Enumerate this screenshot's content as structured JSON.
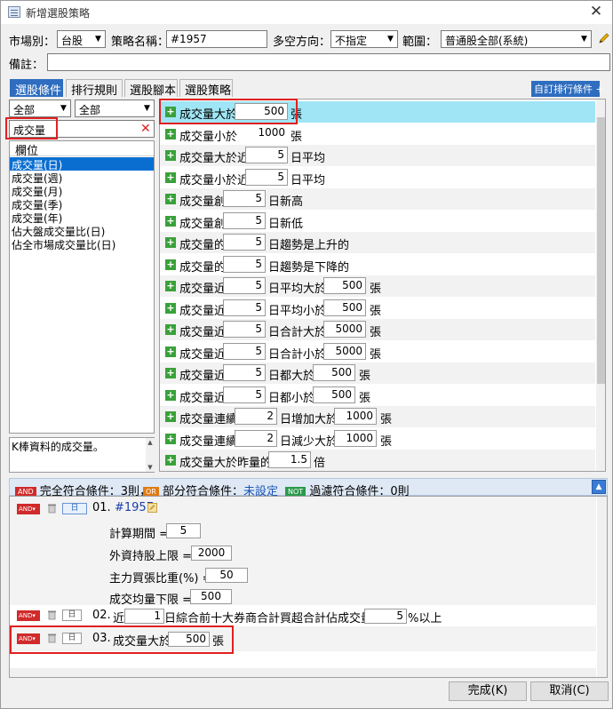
{
  "window": {
    "title": "新增選股策略",
    "close": "✕"
  },
  "header": {
    "market_label": "市場別：",
    "market_value": "台股",
    "strategy_label": "策略名稱：",
    "strategy_value": "#1957",
    "direction_label": "多空方向：",
    "direction_value": "不指定",
    "scope_label": "範圍：",
    "scope_value": "普通股全部(系統)",
    "note_label": "備註：",
    "note_value": ""
  },
  "tabs": [
    "選股條件",
    "排行規則",
    "選股腳本",
    "選股策略"
  ],
  "custom_sort_button": "自訂排行條件 +",
  "left": {
    "filter1": "全部",
    "filter2": "全部",
    "search_value": "成交量",
    "search_clear": "✕",
    "list_header": "欄位",
    "items": [
      "成交量(日)",
      "成交量(週)",
      "成交量(月)",
      "成交量(季)",
      "成交量(年)",
      "佔大盤成交量比(日)",
      "佔全市場成交量比(日)"
    ],
    "description": "K棒資料的成交量。"
  },
  "conditions": [
    {
      "parts": [
        "成交量大於",
        "500",
        "張"
      ]
    },
    {
      "parts": [
        "成交量小於",
        "1000",
        "張"
      ]
    },
    {
      "parts": [
        "成交量大於近",
        "5",
        "日平均"
      ]
    },
    {
      "parts": [
        "成交量小於近",
        "5",
        "日平均"
      ]
    },
    {
      "parts": [
        "成交量創",
        "5",
        "日新高"
      ]
    },
    {
      "parts": [
        "成交量創",
        "5",
        "日新低"
      ]
    },
    {
      "parts": [
        "成交量的",
        "5",
        "日趨勢是上升的"
      ]
    },
    {
      "parts": [
        "成交量的",
        "5",
        "日趨勢是下降的"
      ]
    },
    {
      "parts": [
        "成交量近",
        "5",
        "日平均大於",
        "500",
        "張"
      ]
    },
    {
      "parts": [
        "成交量近",
        "5",
        "日平均小於",
        "500",
        "張"
      ]
    },
    {
      "parts": [
        "成交量近",
        "5",
        "日合計大於",
        "5000",
        "張"
      ]
    },
    {
      "parts": [
        "成交量近",
        "5",
        "日合計小於",
        "5000",
        "張"
      ]
    },
    {
      "parts": [
        "成交量近",
        "5",
        "日都大於",
        "500",
        "張"
      ]
    },
    {
      "parts": [
        "成交量近",
        "5",
        "日都小於",
        "500",
        "張"
      ]
    },
    {
      "parts": [
        "成交量連續",
        "2",
        "日增加大於",
        "1000",
        "張"
      ]
    },
    {
      "parts": [
        "成交量連續",
        "2",
        "日減少大於",
        "1000",
        "張"
      ]
    },
    {
      "parts": [
        "成交量大於昨量的",
        "1.5",
        "倍"
      ]
    }
  ],
  "cond_bar": {
    "and_badge": "AND",
    "and_text": "完全符合條件：3則，",
    "or_badge": "OR",
    "or_label": "部分符合條件：",
    "or_value": "未設定",
    "not_badge": "NOT",
    "not_text": "過濾符合條件：0則"
  },
  "selected": {
    "and_label": "AND▾",
    "day_label": "日",
    "item1": {
      "num": "01.",
      "name": "#1957",
      "params": [
        {
          "label": "計算期間 =",
          "value": "5"
        },
        {
          "label": "外資持股上限 =",
          "value": "2000"
        },
        {
          "label": "主力買張比重(%) =",
          "value": "50"
        },
        {
          "label": "成交均量下限 =",
          "value": "500"
        }
      ]
    },
    "item2": {
      "num": "02.",
      "pre": "近",
      "v1": "1",
      "mid": "日綜合前十大券商合計買超合計佔成交量",
      "v2": "5",
      "post": "%以上"
    },
    "item3": {
      "num": "03.",
      "pre": "成交量大於",
      "v1": "500",
      "post": "張"
    }
  },
  "buttons": {
    "ok": "完成(K)",
    "cancel": "取消(C)"
  }
}
